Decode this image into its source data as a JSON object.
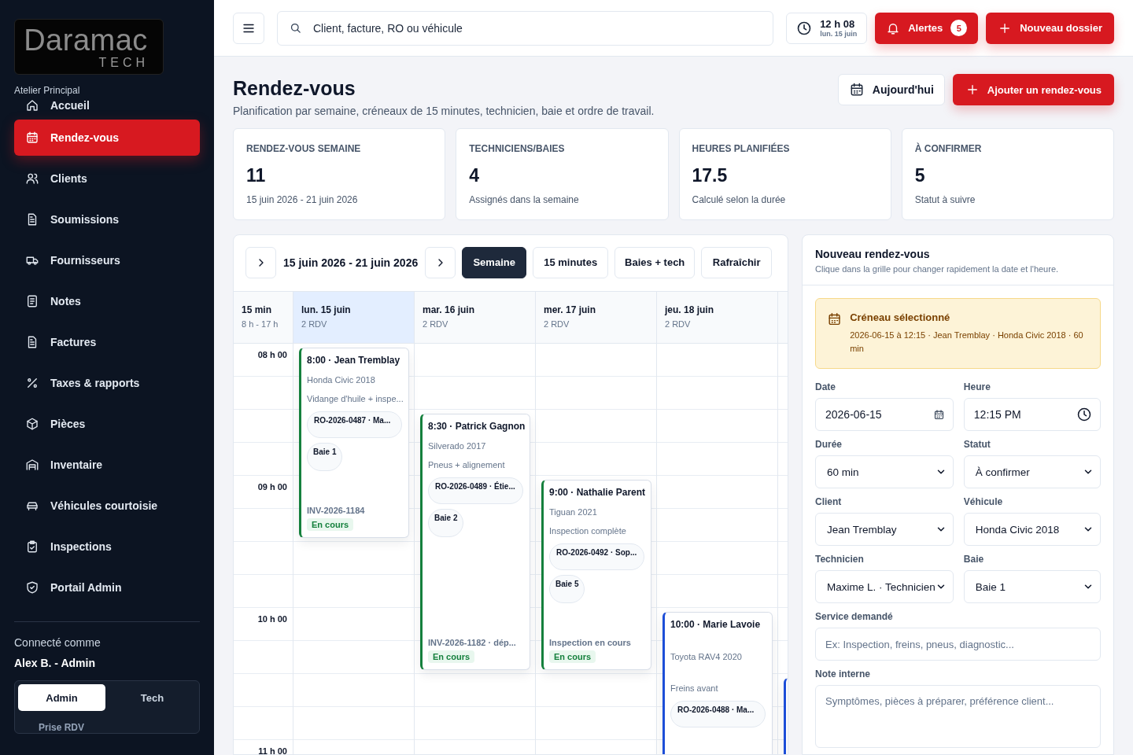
{
  "sidebar": {
    "logo": {
      "name": "Daramac",
      "tagline": "TECH"
    },
    "workshop": "Atelier Principal",
    "items": [
      {
        "label": "Accueil",
        "selected": false
      },
      {
        "label": "Rendez-vous",
        "selected": true
      },
      {
        "label": "Clients",
        "selected": false
      },
      {
        "label": "Soumissions",
        "selected": false
      },
      {
        "label": "Fournisseurs",
        "selected": false
      },
      {
        "label": "Notes",
        "selected": false
      },
      {
        "label": "Factures",
        "selected": false
      },
      {
        "label": "Taxes & rapports",
        "selected": false
      },
      {
        "label": "Pièces",
        "selected": false
      },
      {
        "label": "Inventaire",
        "selected": false
      },
      {
        "label": "Véhicules courtoisie",
        "selected": false
      },
      {
        "label": "Inspections",
        "selected": false
      },
      {
        "label": "Portail Admin",
        "selected": false
      }
    ],
    "user": {
      "caption": "Connecté comme",
      "name": "Alex B. - Admin"
    },
    "role_switch": {
      "options": [
        {
          "label": "Admin",
          "selected": true
        },
        {
          "label": "Tech",
          "selected": false
        }
      ],
      "caption": "Prise RDV"
    }
  },
  "topbar": {
    "search": {
      "placeholder": "Client, facture, RO ou véhicule"
    },
    "clock": {
      "time": "12 h 08",
      "date": "lun. 15 juin"
    },
    "alerts": {
      "label": "Alertes",
      "count": "5"
    },
    "new_button": "Nouveau dossier"
  },
  "page": {
    "title": "Rendez-vous",
    "subtitle": "Planification par semaine, créneaux de 15 minutes, technicien, baie et ordre de travail.",
    "today_button": "Aujourd'hui",
    "add_button": "Ajouter un rendez-vous"
  },
  "stats": [
    {
      "label": "RENDEZ-VOUS SEMAINE",
      "value": "11",
      "note": "15 juin 2026 - 21 juin 2026"
    },
    {
      "label": "TECHNICIENS/BAIES",
      "value": "4",
      "note": "Assignés dans la semaine"
    },
    {
      "label": "HEURES PLANIFIÉES",
      "value": "17.5",
      "note": "Calculé selon la durée"
    },
    {
      "label": "À CONFIRMER",
      "value": "5",
      "note": "Statut à suivre"
    }
  ],
  "calendar": {
    "range": "15 juin 2026 - 21 juin 2026",
    "views": [
      {
        "label": "Semaine",
        "selected": true
      },
      {
        "label": "15 minutes",
        "selected": false
      },
      {
        "label": "Baies + tech",
        "selected": false
      }
    ],
    "refresh": "Rafraîchir",
    "time_header": {
      "label": "15 min",
      "hours": "8 h - 17 h"
    },
    "days": [
      {
        "label": "lun. 15 juin",
        "count": "2 RDV",
        "selected": true
      },
      {
        "label": "mar. 16 juin",
        "count": "2 RDV",
        "selected": false
      },
      {
        "label": "mer. 17 juin",
        "count": "2 RDV",
        "selected": false
      },
      {
        "label": "jeu. 18 juin",
        "count": "2 RDV",
        "selected": false
      }
    ],
    "time_labels": [
      "08 h 00",
      "09 h 00",
      "10 h 00",
      "11 h 00"
    ],
    "events": [
      {
        "kind": "card",
        "color": "#15803d",
        "title": "8:00 · Jean Tremblay",
        "vehicle": "Honda Civic 2018",
        "service": "Vidange d'huile + inspe...",
        "order": "RO-2026-0487 · Ma...",
        "bay": "Baie 1",
        "footer": "INV-2026-1184",
        "status": "En cours"
      },
      {
        "kind": "card",
        "color": "#15803d",
        "title": "8:30 · Patrick Gagnon",
        "vehicle": "Silverado 2017",
        "service": "Pneus + alignement",
        "order": "RO-2026-0489 · Étie...",
        "bay": "Baie 2",
        "footer": "INV-2026-1182 · dép...",
        "status": "En cours"
      },
      {
        "kind": "card",
        "color": "#15803d",
        "title": "9:00 · Nathalie Parent",
        "vehicle": "Tiguan 2021",
        "service": "Inspection complète",
        "order": "RO-2026-0492 · Sop...",
        "bay": "Baie 5",
        "footer": "Inspection en cours",
        "status": "En cours"
      },
      {
        "kind": "card",
        "color": "#1d4ed8",
        "title": "10:00 · Marie Lavoie",
        "vehicle": "Toyota RAV4 2020",
        "service": "Freins avant",
        "order": "RO-2026-0488 · Ma..."
      },
      {
        "kind": "stub",
        "color": "#1d4ed8"
      }
    ]
  },
  "form": {
    "title": "Nouveau rendez-vous",
    "subtitle": "Clique dans la grille pour changer rapidement la date et l'heure.",
    "slot": {
      "title": "Créneau sélectionné",
      "text": "2026-06-15 à 12:15 · Jean Tremblay · Honda Civic 2018 · 60 min"
    },
    "fields": [
      {
        "kind": "date",
        "label": "Date",
        "value": "2026-06-15"
      },
      {
        "kind": "time",
        "label": "Heure",
        "value": "12:15 PM"
      },
      {
        "kind": "select",
        "label": "Durée",
        "value": "60 min"
      },
      {
        "kind": "select",
        "label": "Statut",
        "value": "À confirmer"
      },
      {
        "kind": "select",
        "label": "Client",
        "value": "Jean Tremblay"
      },
      {
        "kind": "select",
        "label": "Véhicule",
        "value": "Honda Civic 2018"
      },
      {
        "kind": "select",
        "label": "Technicien",
        "value": "Maxime L. · Technicien"
      },
      {
        "kind": "select",
        "label": "Baie",
        "value": "Baie 1"
      },
      {
        "kind": "text",
        "label": "Service demandé",
        "placeholder": "Ex: Inspection, freins, pneus, diagnostic..."
      },
      {
        "kind": "textarea",
        "label": "Note interne",
        "placeholder": "Symptômes, pièces à préparer, préférence client..."
      }
    ]
  }
}
